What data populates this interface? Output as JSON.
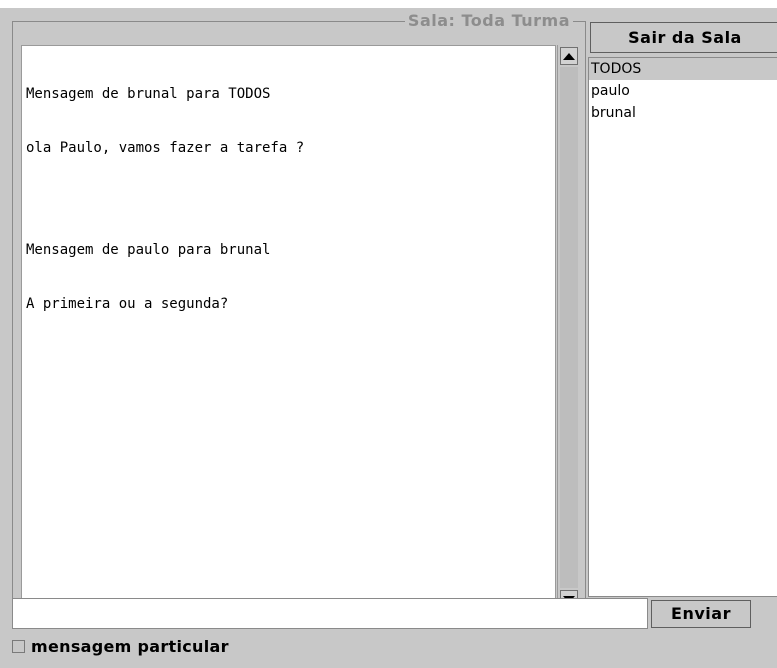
{
  "room": {
    "title": "Sala: Toda Turma",
    "messages": [
      "Mensagem de brunal para TODOS",
      "ola Paulo, vamos fazer a tarefa ?",
      "",
      "Mensagem de paulo para brunal",
      "A primeira ou a segunda?"
    ]
  },
  "sidebar": {
    "leave_label": "Sair da Sala",
    "users": [
      {
        "label": "TODOS",
        "selected": true
      },
      {
        "label": "paulo",
        "selected": false
      },
      {
        "label": "brunal",
        "selected": false
      }
    ]
  },
  "compose": {
    "input_value": "",
    "send_label": "Enviar",
    "private_label": "mensagem particular",
    "private_checked": false
  }
}
